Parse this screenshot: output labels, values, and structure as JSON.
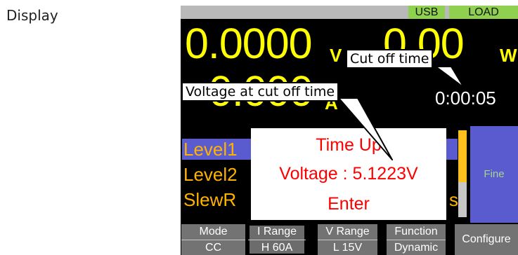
{
  "caption": "Display",
  "status_tags": {
    "usb": "USB",
    "load": "LOAD"
  },
  "readouts": {
    "voltage": "0.0000",
    "voltage_unit": "V",
    "power": "0.00",
    "power_unit": "W",
    "current": "0.000",
    "current_unit": "A",
    "elapsed_time": "0:00:05"
  },
  "list_rows": [
    {
      "label": "Level1",
      "selected": true
    },
    {
      "label": "Level2",
      "selected": false
    },
    {
      "label": "SlewR",
      "selected": false
    }
  ],
  "row2_suffix": "s",
  "side_button": "Fine",
  "dialog": {
    "title": "Time Up",
    "voltage_line": "Voltage : 5.1223V",
    "action": "Enter"
  },
  "softkeys": [
    {
      "top": "Mode",
      "bottom": "CC"
    },
    {
      "top": "I Range",
      "bottom": "H 60A"
    },
    {
      "top": "V Range",
      "bottom": "L 15V"
    },
    {
      "top": "Function",
      "bottom": "Dynamic"
    },
    {
      "top": "Configure"
    }
  ],
  "callouts": {
    "cut_off_time": "Cut off time",
    "voltage_at_cut_off": "Voltage at cut off time"
  },
  "colors": {
    "readout": "#ffff00",
    "list_text": "#ffb300",
    "selection": "#5b5bd0",
    "status_tag": "#8fd14f",
    "dialog_text": "#ff0000"
  }
}
